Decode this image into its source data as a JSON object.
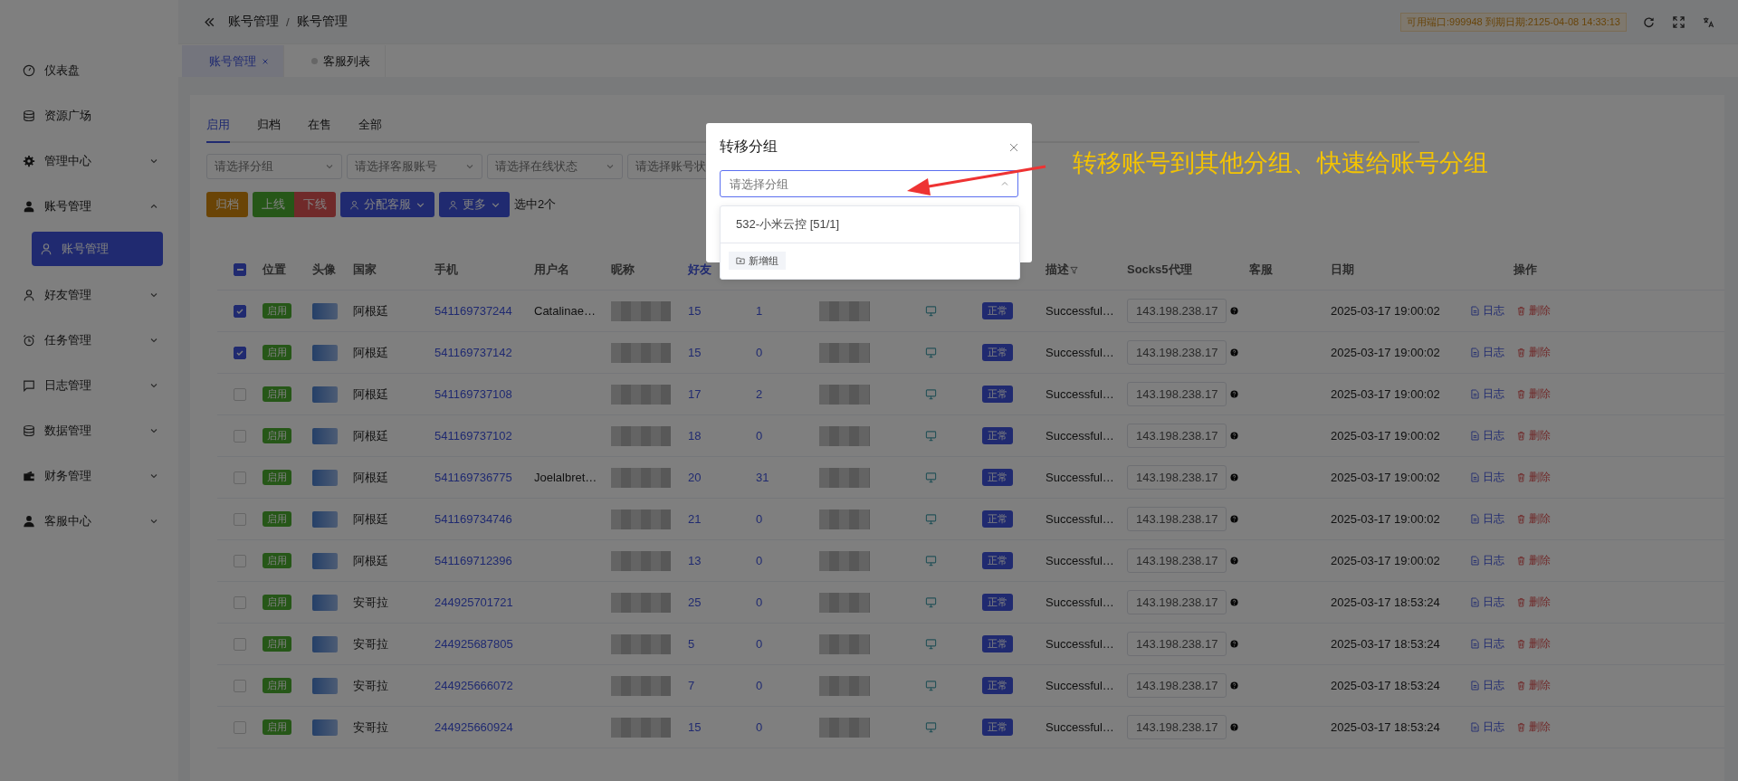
{
  "header": {
    "breadcrumb": [
      "账号管理",
      "账号管理"
    ],
    "breadcrumb_separator": "/",
    "license_badge": "可用端口:999948 到期日期:2125-04-08 14:33:13"
  },
  "page_tabs": [
    {
      "label": "账号管理",
      "selected": true,
      "closable": true
    },
    {
      "label": "客服列表",
      "selected": false,
      "closable": false
    }
  ],
  "sidebar": {
    "items": [
      {
        "label": "仪表盘",
        "expandable": false,
        "expanded": false
      },
      {
        "label": "资源广场",
        "expandable": false,
        "expanded": false
      },
      {
        "label": "管理中心",
        "expandable": true,
        "expanded": false
      },
      {
        "label": "账号管理",
        "expandable": true,
        "expanded": true,
        "children": [
          {
            "label": "账号管理",
            "selected": true
          }
        ]
      },
      {
        "label": "好友管理",
        "expandable": true,
        "expanded": false
      },
      {
        "label": "任务管理",
        "expandable": true,
        "expanded": false
      },
      {
        "label": "日志管理",
        "expandable": true,
        "expanded": false
      },
      {
        "label": "数据管理",
        "expandable": true,
        "expanded": false
      },
      {
        "label": "财务管理",
        "expandable": true,
        "expanded": false
      },
      {
        "label": "客服中心",
        "expandable": true,
        "expanded": false
      }
    ]
  },
  "status_tabs": [
    {
      "label": "启用",
      "selected": true
    },
    {
      "label": "归档",
      "selected": false
    },
    {
      "label": "在售",
      "selected": false
    },
    {
      "label": "全部",
      "selected": false
    }
  ],
  "filters": [
    {
      "placeholder": "请选择分组"
    },
    {
      "placeholder": "请选择客服账号"
    },
    {
      "placeholder": "请选择在线状态"
    },
    {
      "placeholder": "请选择账号状"
    }
  ],
  "toolbar": {
    "buttons": [
      {
        "label": "归档",
        "kind": "warning",
        "icon": false,
        "dropdown": false
      },
      {
        "label": "上线",
        "kind": "success",
        "icon": false,
        "dropdown": false
      },
      {
        "label": "下线",
        "kind": "danger",
        "icon": false,
        "dropdown": false
      },
      {
        "label": "分配客服",
        "kind": "primary",
        "icon": true,
        "dropdown": true
      },
      {
        "label": "更多",
        "kind": "primary",
        "icon": true,
        "dropdown": true
      }
    ],
    "selection_text": "选中2个"
  },
  "table": {
    "select_all_indeterminate": true,
    "columns": [
      {
        "label": "位置",
        "active": false
      },
      {
        "label": "头像",
        "active": false
      },
      {
        "label": "国家",
        "active": false
      },
      {
        "label": "手机",
        "active": false
      },
      {
        "label": "用户名",
        "active": false
      },
      {
        "label": "昵称",
        "active": false
      },
      {
        "label": "好友",
        "active": true
      },
      {
        "label": "描述",
        "active": false,
        "filter": true
      },
      {
        "label": "Socks5代理",
        "active": false
      },
      {
        "label": "客服",
        "active": false
      },
      {
        "label": "日期",
        "active": false
      },
      {
        "label": "操作",
        "active": false
      }
    ],
    "rows": [
      {
        "checked": true,
        "position": "启用",
        "country": "阿根廷",
        "phone": "541169737244",
        "username": "Catalinae…",
        "friends": "15",
        "column_9": "1",
        "status": "正常",
        "description": "Successful…",
        "proxy": "143.198.238.17",
        "date": "2025-03-17 19:00:02",
        "log": "日志",
        "delete": "删除"
      },
      {
        "checked": true,
        "position": "启用",
        "country": "阿根廷",
        "phone": "541169737142",
        "friends": "15",
        "column_9": "0",
        "status": "正常",
        "description": "Successful…",
        "proxy": "143.198.238.17",
        "date": "2025-03-17 19:00:02",
        "log": "日志",
        "delete": "删除"
      },
      {
        "checked": false,
        "position": "启用",
        "country": "阿根廷",
        "phone": "541169737108",
        "friends": "17",
        "column_9": "2",
        "status": "正常",
        "description": "Successful…",
        "proxy": "143.198.238.17",
        "date": "2025-03-17 19:00:02",
        "log": "日志",
        "delete": "删除"
      },
      {
        "checked": false,
        "position": "启用",
        "country": "阿根廷",
        "phone": "541169737102",
        "friends": "18",
        "column_9": "0",
        "status": "正常",
        "description": "Successful…",
        "proxy": "143.198.238.17",
        "date": "2025-03-17 19:00:02",
        "log": "日志",
        "delete": "删除"
      },
      {
        "checked": false,
        "position": "启用",
        "country": "阿根廷",
        "phone": "541169736775",
        "username": "Joelalbret…",
        "friends": "20",
        "column_9": "31",
        "status": "正常",
        "description": "Successful…",
        "proxy": "143.198.238.17",
        "date": "2025-03-17 19:00:02",
        "log": "日志",
        "delete": "删除"
      },
      {
        "checked": false,
        "position": "启用",
        "country": "阿根廷",
        "phone": "541169734746",
        "friends": "21",
        "column_9": "0",
        "status": "正常",
        "description": "Successful…",
        "proxy": "143.198.238.17",
        "date": "2025-03-17 19:00:02",
        "log": "日志",
        "delete": "删除"
      },
      {
        "checked": false,
        "position": "启用",
        "country": "阿根廷",
        "phone": "541169712396",
        "friends": "13",
        "column_9": "0",
        "status": "正常",
        "description": "Successful…",
        "proxy": "143.198.238.17",
        "date": "2025-03-17 19:00:02",
        "log": "日志",
        "delete": "删除"
      },
      {
        "checked": false,
        "position": "启用",
        "country": "安哥拉",
        "phone": "244925701721",
        "friends": "25",
        "column_9": "0",
        "status": "正常",
        "description": "Successful…",
        "proxy": "143.198.238.17",
        "date": "2025-03-17 18:53:24",
        "log": "日志",
        "delete": "删除"
      },
      {
        "checked": false,
        "position": "启用",
        "country": "安哥拉",
        "phone": "244925687805",
        "friends": "5",
        "column_9": "0",
        "status": "正常",
        "description": "Successful…",
        "proxy": "143.198.238.17",
        "date": "2025-03-17 18:53:24",
        "log": "日志",
        "delete": "删除"
      },
      {
        "checked": false,
        "position": "启用",
        "country": "安哥拉",
        "phone": "244925666072",
        "friends": "7",
        "column_9": "0",
        "status": "正常",
        "description": "Successful…",
        "proxy": "143.198.238.17",
        "date": "2025-03-17 18:53:24",
        "log": "日志",
        "delete": "删除"
      },
      {
        "checked": false,
        "position": "启用",
        "country": "安哥拉",
        "phone": "244925660924",
        "friends": "15",
        "column_9": "0",
        "status": "正常",
        "description": "Successful…",
        "proxy": "143.198.238.17",
        "date": "2025-03-17 18:53:24",
        "log": "日志",
        "delete": "删除"
      }
    ]
  },
  "modal": {
    "title": "转移分组",
    "select": {
      "placeholder": "请选择分组",
      "focused": true
    },
    "options": [
      {
        "label": "532-小米云控 [51/1]"
      }
    ],
    "add_button": "新增组"
  },
  "annotation": {
    "text": "转移账号到其他分组、快速给账号分组"
  }
}
